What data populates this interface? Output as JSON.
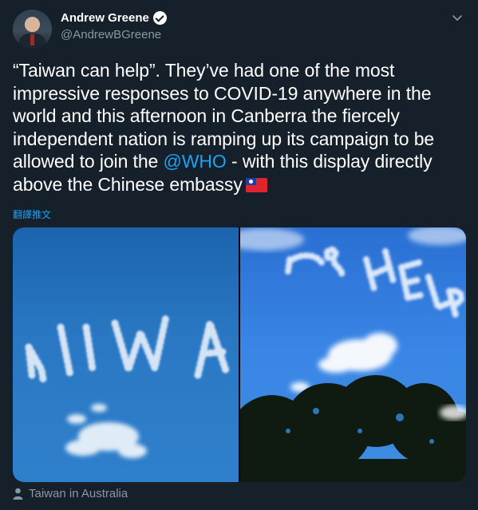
{
  "author": {
    "display_name": "Andrew Greene",
    "handle": "@AndrewBGreene",
    "verified": true
  },
  "tweet": {
    "text_before_mention": "“Taiwan can help”. They’ve had one of the most impressive responses to COVID-19 anywhere in the world and this afternoon in Canberra the fiercely independent nation is ramping up its campaign to be allowed to join the ",
    "mention": "@WHO",
    "text_after_mention": " - with this display directly above the Chinese embassy",
    "emoji": "taiwan-flag-icon",
    "translate_label": "翻譯推文"
  },
  "media": {
    "photos": [
      {
        "skywriting": "IAIWA"
      },
      {
        "skywriting": "AN HELP"
      }
    ]
  },
  "location": {
    "label": "Taiwan in Australia"
  },
  "colors": {
    "background": "#15202b",
    "text": "#ffffff",
    "secondary_text": "#8899a6",
    "accent": "#1da1f2"
  }
}
